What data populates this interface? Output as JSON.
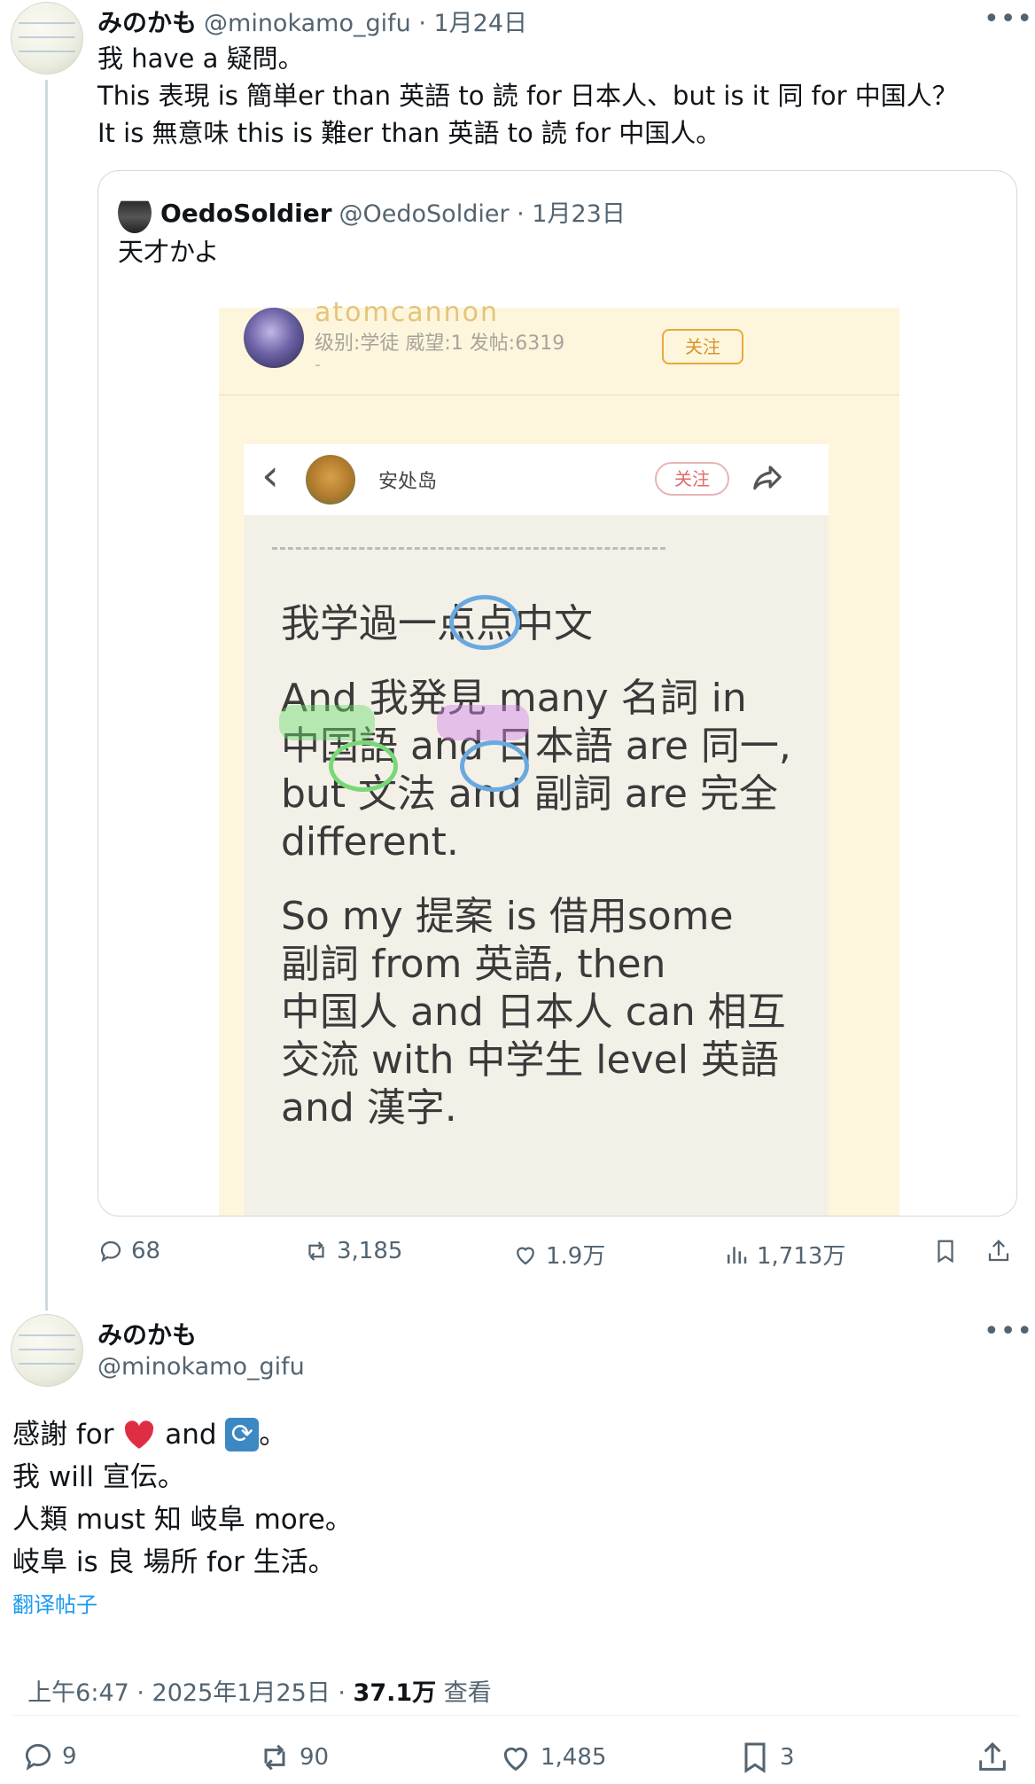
{
  "tweet1": {
    "display_name": "みのかも",
    "handle_time": "@minokamo_gifu · 1月24日",
    "lines": [
      "我 have a 疑問。",
      "This 表現 is 簡単er than 英語 to 読 for 日本人、but is it 同 for 中国人？",
      "It is 無意味 this is 難er than 英語 to 読 for 中国人。"
    ],
    "quote": {
      "display_name": "OedoSoldier",
      "handle_time": "@OedoSoldier · 1月23日",
      "text": "天才かよ",
      "image": {
        "username": "atomcannon",
        "meta": "级别:学徒 威望:1 发帖:6319",
        "dash": "-",
        "follow_label": "关注",
        "inner": {
          "back": "‹",
          "name": "安处岛",
          "follow_label": "关注",
          "paragraphs": [
            [
              "我学過一点点中文"
            ],
            [
              "And 我発見 many 名詞 in",
              "中国語 and 日本語 are 同一,",
              "but 文法  and 副詞 are  完全",
              " different."
            ],
            [
              "So my 提案 is 借用some",
              "副詞 from 英語,  then",
              "中国人 and 日本人 can 相互",
              "交流 with 中学生 level 英語",
              "and 漢字."
            ]
          ]
        }
      }
    },
    "stats": {
      "replies": "68",
      "reposts": "3,185",
      "likes": "1.9万",
      "views": "1,713万"
    }
  },
  "tweet2": {
    "display_name": "みのかも",
    "handle": "@minokamo_gifu",
    "line1_a": "感謝 for ",
    "line1_b": " and ",
    "line1_c": "。",
    "lines": [
      "我 will 宣伝。",
      "人類 must 知 岐阜 more。",
      "岐阜 is 良 場所 for 生活。"
    ],
    "translate_link": "翻译帖子",
    "timestamp": "上午6:47 · 2025年1月25日 · ",
    "views_count": "37.1万",
    "views_label": " 查看",
    "stats": {
      "replies": "9",
      "reposts": "90",
      "likes": "1,485",
      "bookmarks": "3"
    }
  },
  "colors": {
    "accent": "#1d9bf0",
    "heart": "#e0245e",
    "follow_orange": "#e8a93a",
    "follow_red": "#e06a6a"
  },
  "icons": [
    "more-icon",
    "reply-icon",
    "repost-icon",
    "like-icon",
    "views-icon",
    "bookmark-icon",
    "share-icon",
    "heart-emoji",
    "repeat-emoji",
    "back-icon",
    "share-arrow-icon"
  ]
}
